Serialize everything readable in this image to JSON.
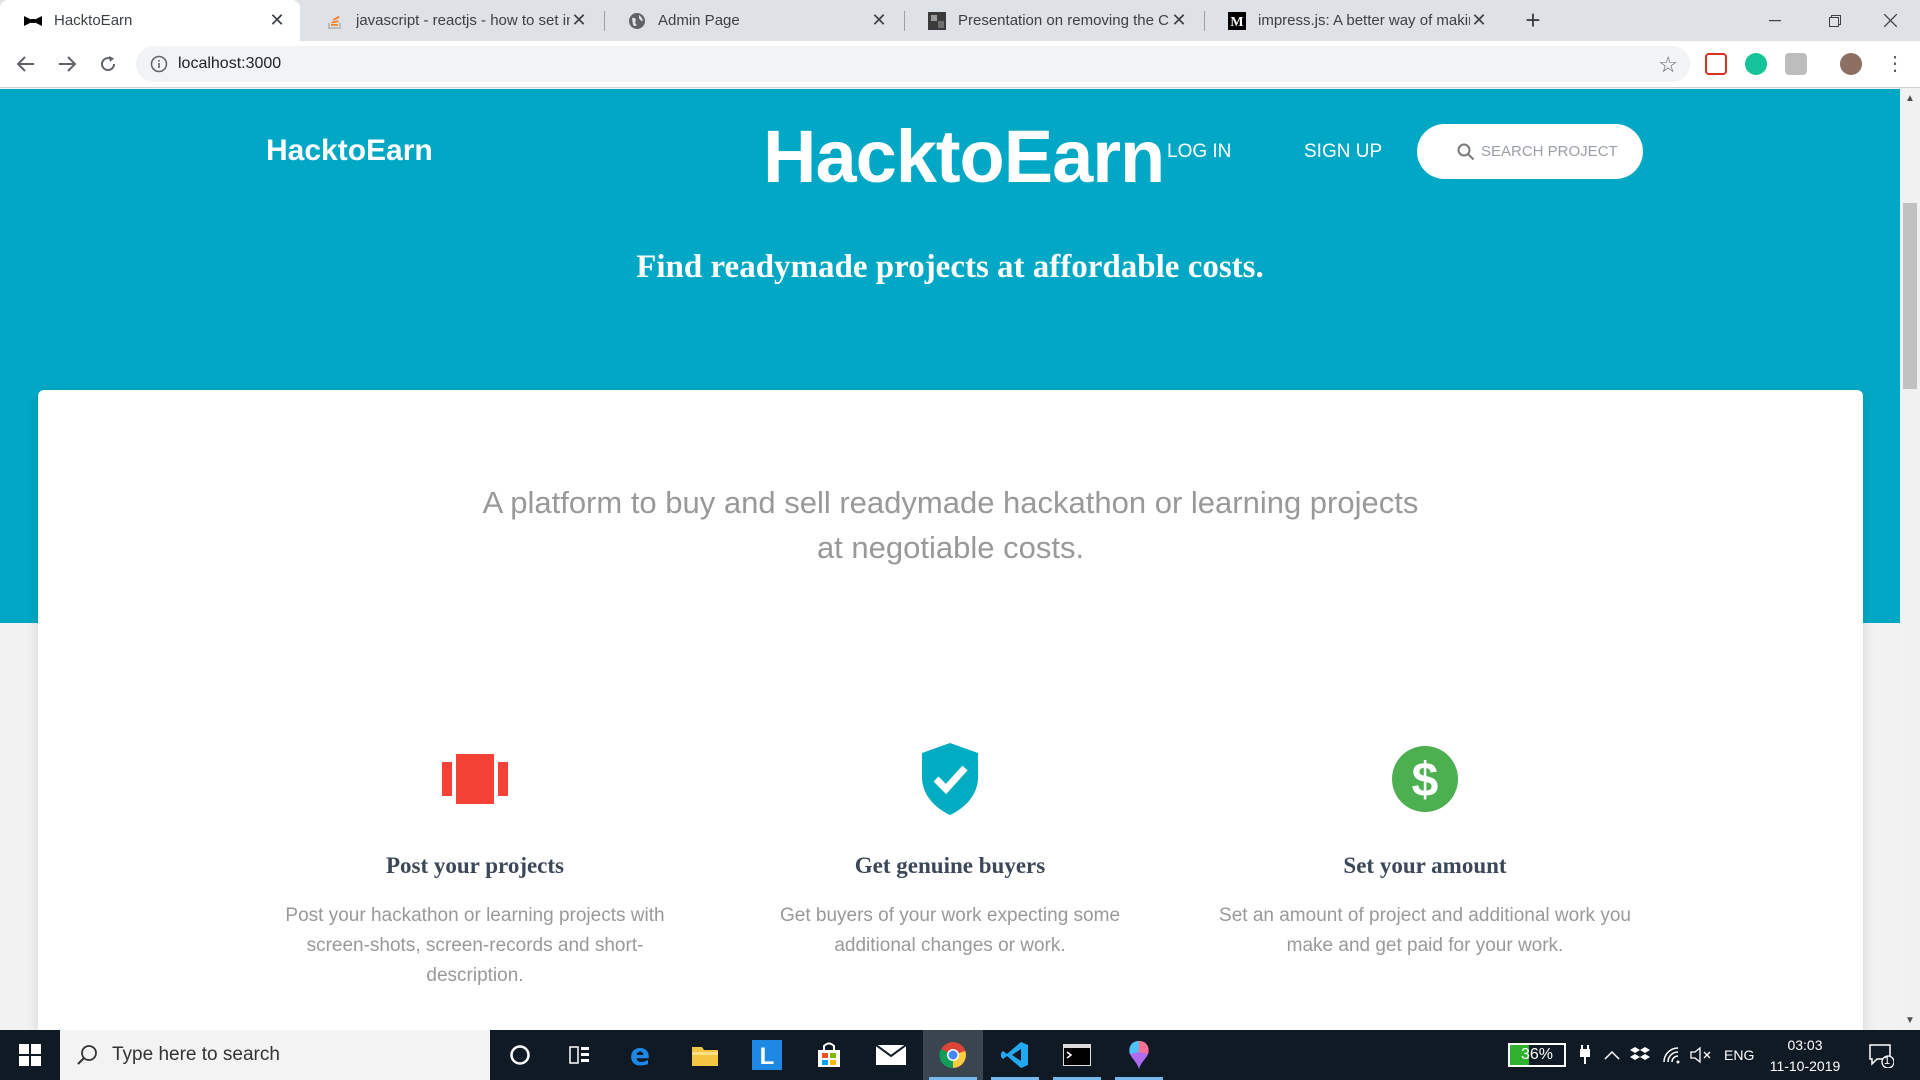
{
  "browser": {
    "tabs": [
      {
        "title": "HacktoEarn",
        "favicon": "bowtie-icon",
        "active": true
      },
      {
        "title": "javascript - reactjs - how to set in",
        "favicon": "stackoverflow-icon",
        "active": false
      },
      {
        "title": "Admin Page",
        "favicon": "globe-icon",
        "active": false
      },
      {
        "title": "Presentation on removing the Cl",
        "favicon": "image-thumb-icon",
        "active": false
      },
      {
        "title": "impress.js: A better way of makin",
        "favicon": "medium-icon",
        "active": false
      }
    ],
    "url": "localhost:3000"
  },
  "header": {
    "brand_left": "HacktoEarn",
    "brand_center": "HacktoEarn",
    "login": "LOG IN",
    "signup": "SIGN UP",
    "search_placeholder": "SEARCH PROJECT"
  },
  "hero": {
    "tagline": "Find readymade projects at affordable costs."
  },
  "content": {
    "intro_line1": "A platform to buy and sell readymade hackathon or learning projects",
    "intro_line2": "at negotiable costs.",
    "features": [
      {
        "icon": "book-columns-icon",
        "title": "Post your projects",
        "desc": "Post your hackathon or learning projects with screen-shots, screen-records and short-description.",
        "color": "#f44336"
      },
      {
        "icon": "shield-check-icon",
        "title": "Get genuine buyers",
        "desc": "Get buyers of your work expecting some additional changes or work.",
        "color": "#00acc1"
      },
      {
        "icon": "dollar-circle-icon",
        "title": "Set your amount",
        "desc": "Set an amount of project and additional work you make and get paid for your work.",
        "color": "#4caf50"
      }
    ]
  },
  "taskbar": {
    "search_placeholder": "Type here to search",
    "battery": "36%",
    "battery_level": 0.36,
    "language": "ENG",
    "time": "03:03",
    "date": "11-10-2019",
    "notification_count": "1"
  },
  "colors": {
    "hero_bg": "#00a8c6",
    "taskbar_bg": "#101a24"
  }
}
